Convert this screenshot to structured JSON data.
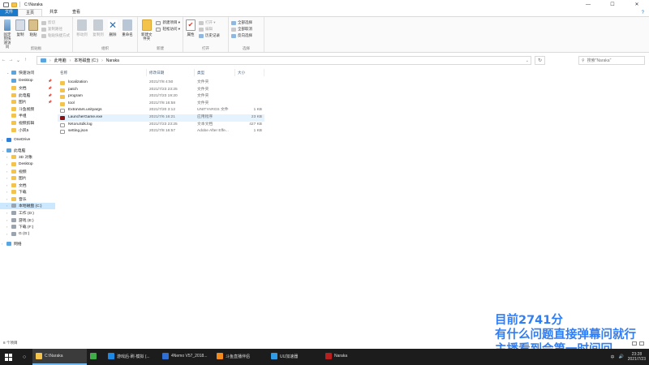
{
  "window": {
    "title": "C:\\Naraka",
    "controls": {
      "minimize": "—",
      "maximize": "☐",
      "close": "✕"
    }
  },
  "ribbon_tabs": {
    "file": "文件",
    "home": "主页",
    "share": "共享",
    "view": "查看",
    "help": "?"
  },
  "ribbon": {
    "clipboard": {
      "group_name": "剪贴板",
      "pin_label": "固定到快速访问",
      "copy_label": "复制",
      "paste_label": "粘贴",
      "cut_label": "剪切",
      "copy_path_label": "复制路径",
      "paste_shortcut_label": "粘贴快捷方式"
    },
    "organize": {
      "group_name": "组织",
      "move_to_label": "移动到",
      "copy_to_label": "复制到",
      "delete_label": "删除",
      "rename_label": "重命名"
    },
    "new": {
      "group_name": "新建",
      "new_folder_label": "新建文件夹",
      "new_item_label": "新建项目 ▾",
      "easy_access_label": "轻松访问 ▾"
    },
    "open": {
      "group_name": "打开",
      "properties_label": "属性",
      "open_label": "打开 ▾",
      "edit_label": "编辑",
      "history_label": "历史记录"
    },
    "select": {
      "group_name": "选择",
      "select_all_label": "全部选择",
      "select_none_label": "全部取消",
      "invert_label": "反向选择"
    }
  },
  "address": {
    "back": "←",
    "forward": "→",
    "recent": "⌄",
    "up": "↑",
    "crumbs": [
      "此电脑",
      "本地磁盘 (C:)",
      "Naraka"
    ],
    "refresh": "↻",
    "search_placeholder": "搜索\"Naraka\""
  },
  "nav": {
    "quick_access": "快速访问",
    "quick_items": [
      "Desktop",
      "文档",
      "此电脑",
      "图片",
      "斗鱼视频",
      "半组",
      "视频剪辑",
      "小风5"
    ],
    "onedrive": "OneDrive",
    "this_pc": "此电脑",
    "pc_items": [
      "3D 对象",
      "Desktop",
      "视频",
      "图片",
      "文档",
      "下载",
      "音乐",
      "本地磁盘 (C:)",
      "工作 (D:)",
      "游戏 (E:)",
      "下载 (F:)",
      "G (G:)"
    ],
    "network": "网络"
  },
  "columns": {
    "name": "名称",
    "date": "修改日期",
    "type": "类型",
    "size": "大小"
  },
  "files": [
    {
      "name": "localization",
      "date": "2021/7/8 4:50",
      "type": "文件夹",
      "size": "",
      "kind": "folder"
    },
    {
      "name": "patch",
      "date": "2021/7/23 23:25",
      "type": "文件夹",
      "size": "",
      "kind": "folder"
    },
    {
      "name": "program",
      "date": "2021/7/23 19:20",
      "type": "文件夹",
      "size": "",
      "kind": "folder"
    },
    {
      "name": "tool",
      "date": "2021/7/8 16:58",
      "type": "文件夹",
      "size": "",
      "kind": "folder"
    },
    {
      "name": "ExtraVars.unityargs",
      "date": "2021/7/20 3:12",
      "type": "UNITYARGS 文件",
      "size": "1 KB",
      "kind": "file"
    },
    {
      "name": "LauncherGame.exe",
      "date": "2021/7/6 16:21",
      "type": "应用程序",
      "size": "23 KB",
      "kind": "exe"
    },
    {
      "name": "NKoruSdk.log",
      "date": "2021/7/23 23:25",
      "type": "文本文档",
      "size": "427 KB",
      "kind": "file"
    },
    {
      "name": "setting.json",
      "date": "2021/7/8 16:57",
      "type": "Adobe After Effe...",
      "size": "1 KB",
      "kind": "file"
    }
  ],
  "status": {
    "count": "8 个项目"
  },
  "overlay": {
    "line1": "目前2741分",
    "line2": "有什么问题直接弹幕问就行",
    "line3": "主播看到会第一时间回"
  },
  "taskbar": {
    "apps": [
      {
        "label": "C:\\Naraka",
        "color": "#f3c34b",
        "active": true
      },
      {
        "label": "",
        "color": "#3fae49",
        "active": false
      },
      {
        "label": "游戏后·刷·模拟 (...",
        "color": "#1e88e5",
        "active": false
      },
      {
        "label": "4Nemo V57_2018...",
        "color": "#2f6fd6",
        "active": false
      },
      {
        "label": "斗鱼直播伴侣",
        "color": "#f28a1d",
        "active": false
      },
      {
        "label": "UU加速器",
        "color": "#2f9ae6",
        "active": false
      },
      {
        "label": "Naraka",
        "color": "#b81f1f",
        "active": false
      }
    ],
    "tray": {
      "ime": "中",
      "volume": "🔊",
      "time": "23:28",
      "date": "2021/7/23"
    }
  },
  "accent": "#1979ca"
}
